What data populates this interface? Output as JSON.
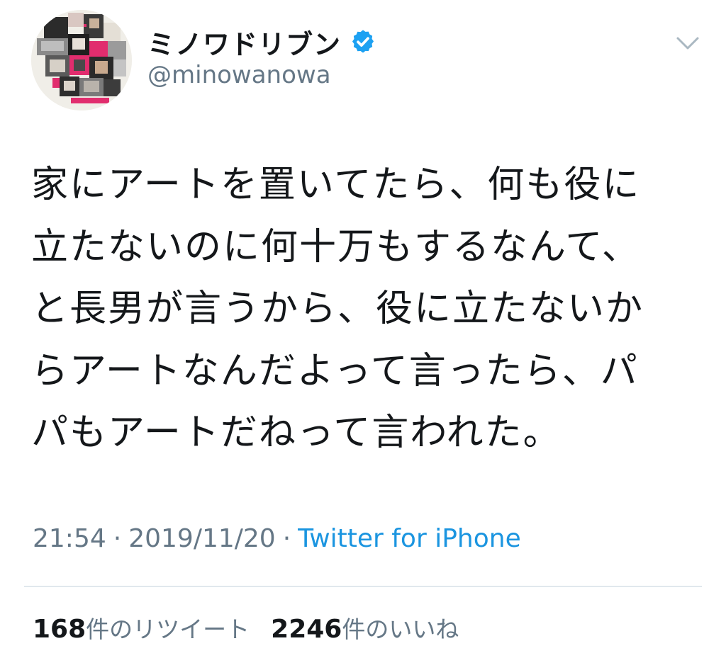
{
  "author": {
    "display_name": "ミノワドリブン",
    "handle": "@minowanowa",
    "verified": true
  },
  "tweet": {
    "lines": [
      "家にアートを置いてたら、何も役に",
      "立たないのに何十万もするなんて、",
      "と長男が言うから、役に立たないか",
      "らアートなんだよって言ったら、パ",
      "パもアートだねって言われた。"
    ]
  },
  "meta": {
    "time": "21:54",
    "date": "2019/11/20",
    "separator": "·",
    "source": "Twitter for iPhone"
  },
  "stats": {
    "retweets": {
      "count": "168",
      "label": "件のリツイート"
    },
    "likes": {
      "count": "2246",
      "label": "件のいいね"
    }
  },
  "icons": {
    "verified": "verified-badge-icon",
    "menu": "chevron-down-icon"
  },
  "colors": {
    "text": "#14171a",
    "secondary": "#657786",
    "link": "#1b95e0",
    "verified": "#1da1f2",
    "divider": "#e1e8ed"
  }
}
